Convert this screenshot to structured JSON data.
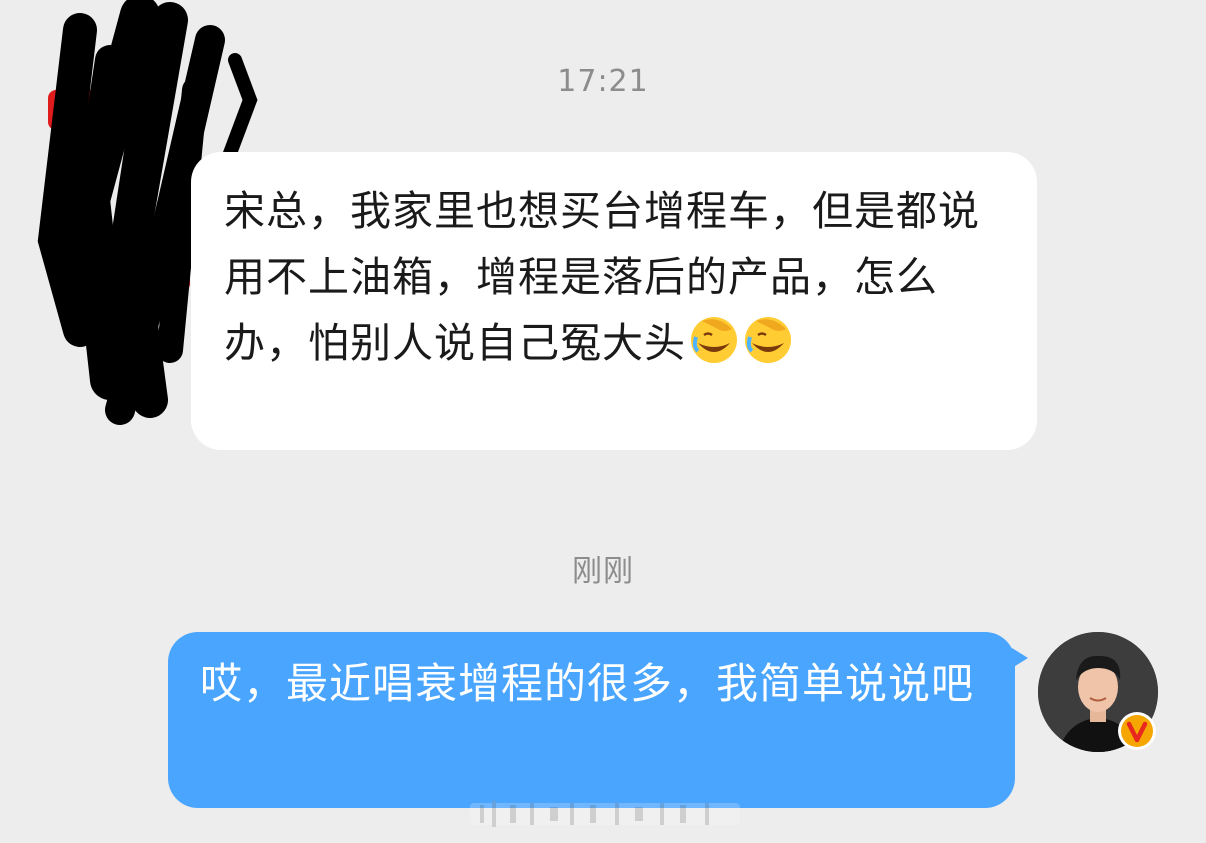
{
  "chat": {
    "timestamp_first": "17:21",
    "timestamp_second": "刚刚",
    "incoming_message": "宋总，我家里也想买台增程车，但是都说用不上油箱，增程是落后的产品，怎么办，怕别人说自己冤大头",
    "outgoing_message": "哎，最近唱衰增程的很多，我简单说说吧"
  },
  "icons": {
    "incoming_avatar": "redacted-avatar-icon",
    "emoji": "facepalm-laugh-emoji-icon",
    "outgoing_avatar": "user-avatar-icon",
    "verified_badge": "verified-v-badge-icon"
  },
  "colors": {
    "background": "#ededed",
    "incoming_bubble": "#ffffff",
    "outgoing_bubble": "#4aa5ff",
    "timestamp_text": "#8c8c8c",
    "verified_badge": "#f5a600"
  }
}
